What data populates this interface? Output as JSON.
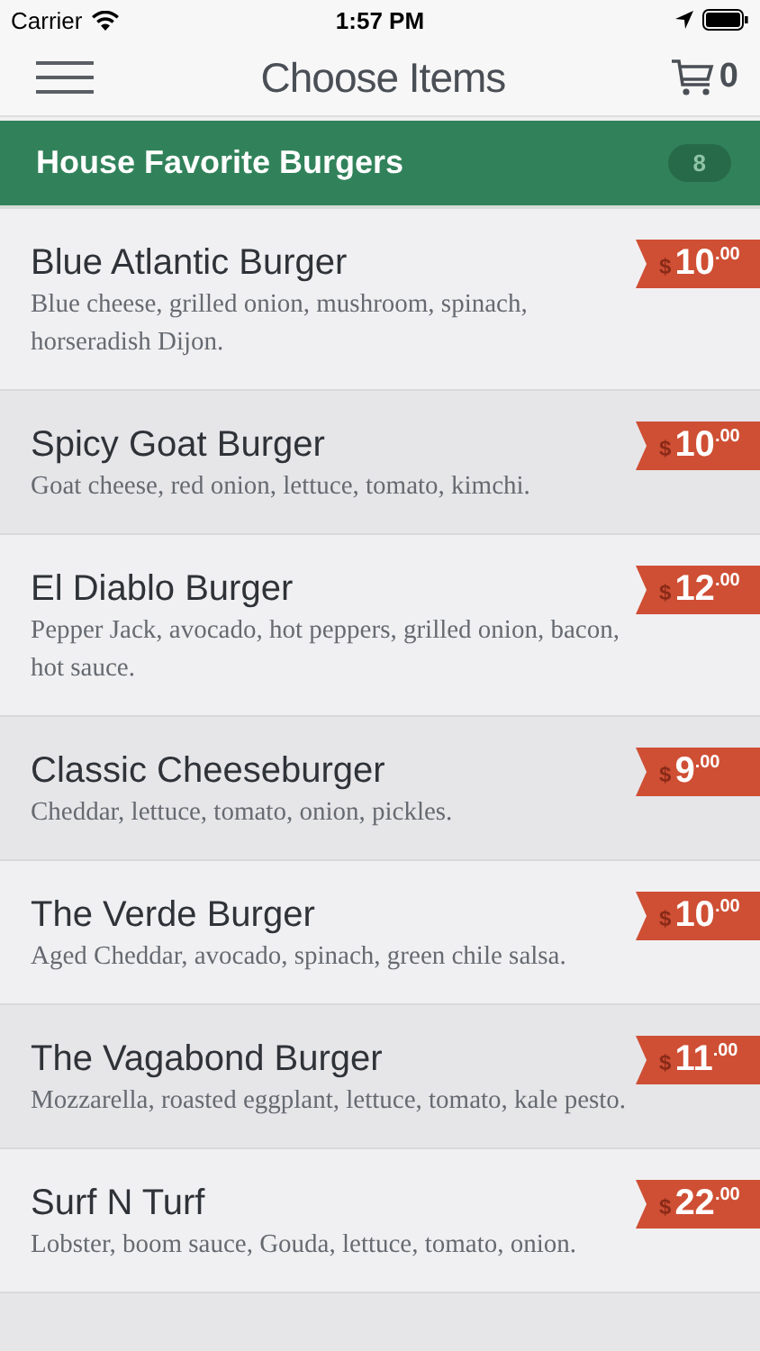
{
  "status_bar": {
    "carrier": "Carrier",
    "time": "1:57 PM"
  },
  "nav": {
    "title": "Choose Items",
    "cart_count": "0"
  },
  "section": {
    "title": "House Favorite Burgers",
    "count": "8"
  },
  "items": [
    {
      "name": "Blue Atlantic Burger",
      "description": "Blue cheese, grilled onion, mushroom, spinach, horseradish Dijon.",
      "currency": "$",
      "dollars": "10",
      "cents": ".00"
    },
    {
      "name": "Spicy Goat Burger",
      "description": "Goat cheese, red onion, lettuce, tomato, kimchi.",
      "currency": "$",
      "dollars": "10",
      "cents": ".00"
    },
    {
      "name": "El Diablo Burger",
      "description": "Pepper Jack, avocado, hot peppers, grilled onion, bacon, hot sauce.",
      "currency": "$",
      "dollars": "12",
      "cents": ".00"
    },
    {
      "name": "Classic Cheeseburger",
      "description": "Cheddar, lettuce, tomato, onion, pickles.",
      "currency": "$",
      "dollars": "9",
      "cents": ".00"
    },
    {
      "name": "The Verde Burger",
      "description": "Aged Cheddar, avocado, spinach, green chile salsa.",
      "currency": "$",
      "dollars": "10",
      "cents": ".00"
    },
    {
      "name": "The Vagabond Burger",
      "description": "Mozzarella, roasted eggplant, lettuce, tomato, kale pesto.",
      "currency": "$",
      "dollars": "11",
      "cents": ".00"
    },
    {
      "name": "Surf N Turf",
      "description": "Lobster, boom sauce, Gouda, lettuce, tomato, onion.",
      "currency": "$",
      "dollars": "22",
      "cents": ".00"
    }
  ]
}
